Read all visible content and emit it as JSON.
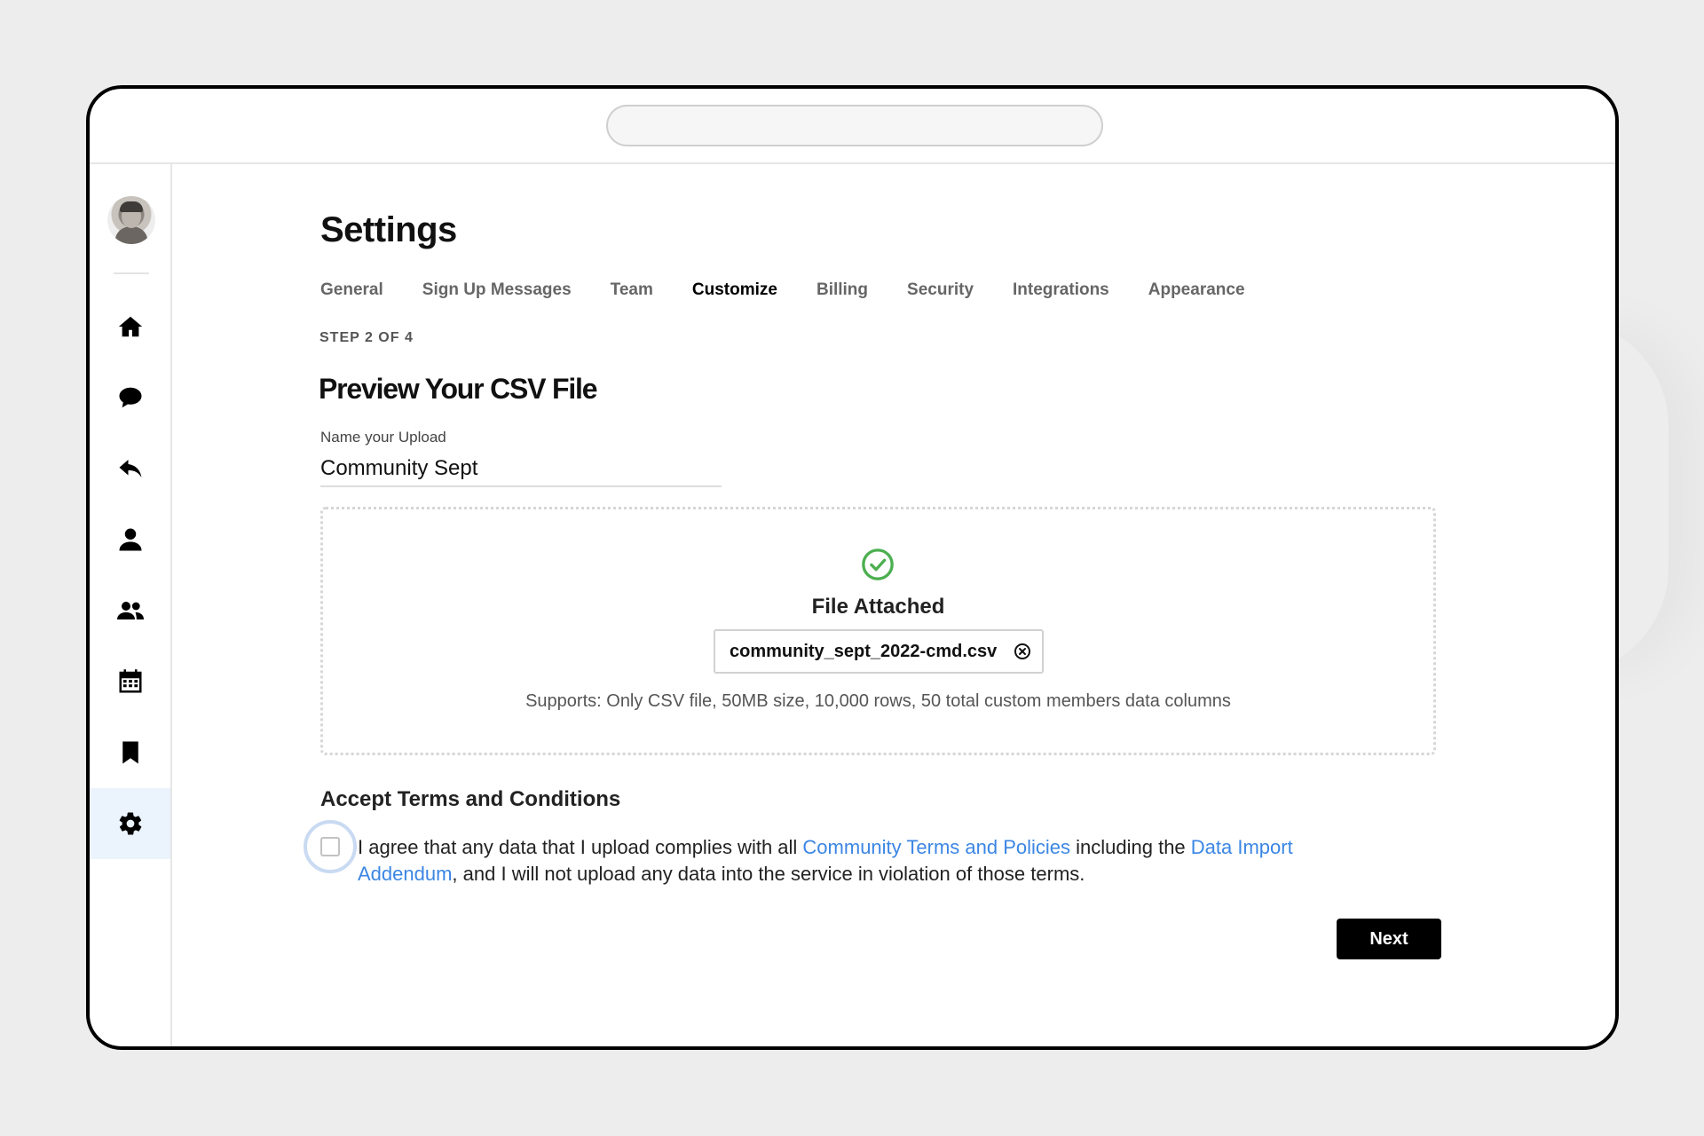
{
  "browser": {
    "url": ""
  },
  "sidebar": {
    "items": [
      {
        "icon": "home-icon"
      },
      {
        "icon": "chat-bubble-icon"
      },
      {
        "icon": "reply-icon"
      },
      {
        "icon": "user-icon"
      },
      {
        "icon": "group-icon"
      },
      {
        "icon": "calendar-icon"
      },
      {
        "icon": "bookmark-icon"
      },
      {
        "icon": "gear-icon",
        "active": true
      }
    ]
  },
  "page": {
    "title": "Settings"
  },
  "tabs": [
    {
      "label": "General"
    },
    {
      "label": "Sign Up Messages"
    },
    {
      "label": "Team"
    },
    {
      "label": "Customize",
      "active": true
    },
    {
      "label": "Billing"
    },
    {
      "label": "Security"
    },
    {
      "label": "Integrations"
    },
    {
      "label": "Appearance"
    }
  ],
  "wizard": {
    "step": "STEP 2 OF 4",
    "title": "Preview Your CSV File",
    "name_label": "Name your Upload",
    "name_value": "Community Sept"
  },
  "upload": {
    "status": "File Attached",
    "file_name": "community_sept_2022-cmd.csv",
    "supports": "Supports: Only CSV file, 50MB size, 10,000 rows, 50 total custom members data columns",
    "status_color": "#4caf50"
  },
  "terms": {
    "title": "Accept Terms and Conditions",
    "text_1": "I agree that any data that I upload complies with all ",
    "link_1": "Community Terms and Policies",
    "text_2": " including the ",
    "link_2": "Data Import Addendum",
    "text_3": ", and I will not upload any data into the service in violation of those terms.",
    "checked": false,
    "link_color": "#3b86e4"
  },
  "actions": {
    "next_label": "Next"
  }
}
